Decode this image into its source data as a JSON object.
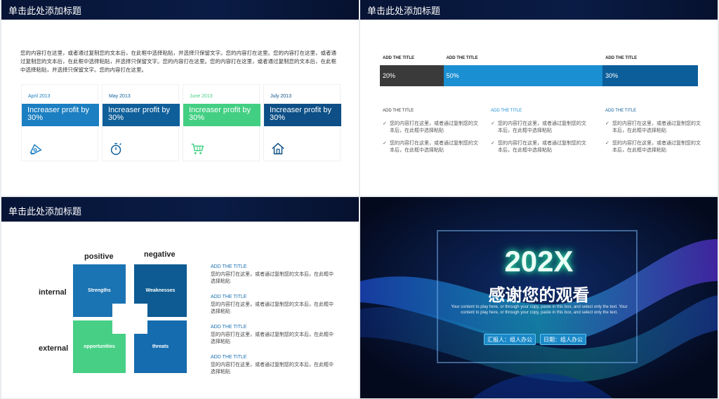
{
  "slide1": {
    "title": "单击此处添加标题",
    "paragraph": "您的内容打在这里，或者通过复制您的文本后，在此框中选择粘贴，并选择只保留文字。您的内容打在这里。您的内容打在这里，或者通过复制您的文本后，在此框中选择粘贴，并选择只保留文字。您的内容打在这里。您的内容打在这里，或者通过复制您的文本后，在此框中选择粘贴，并选择只保留文字。您的内容打在这里。",
    "cards": [
      {
        "month": "April 2013",
        "text": "Increaser profit by 30%",
        "color": "#1b7fc1",
        "icon": "pen-nib-icon"
      },
      {
        "month": "May 2013",
        "text": "Increaser profit by 30%",
        "color": "#0f5f9a",
        "icon": "stopwatch-icon"
      },
      {
        "month": "June 2013",
        "text": "Increaser profit by 30%",
        "color": "#43cf83",
        "icon": "shopping-cart-icon"
      },
      {
        "month": "July 2013",
        "text": "Increaser profit by 30%",
        "color": "#0d4f86",
        "icon": "house-icon"
      }
    ]
  },
  "slide2": {
    "title": "单击此处添加标题",
    "bar_heads": [
      "ADD THE TITLE",
      "ADD THE TITLE",
      "ADD THE TITLE"
    ],
    "bars": [
      {
        "label": "20%",
        "value": 20,
        "color": "#3a3a3a"
      },
      {
        "label": "50%",
        "value": 50,
        "color": "#1a8fd2"
      },
      {
        "label": "30%",
        "value": 30,
        "color": "#0c5e9a"
      }
    ],
    "columns": [
      {
        "title": "ADD THE TITLE",
        "items": [
          "您的内容打在这里，或者通过复制您的文本后，在此框中选择粘贴",
          "您的内容打在这里，或者通过复制您的文本后，在此框中选择粘贴"
        ]
      },
      {
        "title": "ADD THE TITLE",
        "items": [
          "您的内容打在这里，或者通过复制您的文本后，在此框中选择粘贴",
          "您的内容打在这里，或者通过复制您的文本后，在此框中选择粘贴"
        ]
      },
      {
        "title": "ADD THE TITLE",
        "items": [
          "您的内容打在这里，或者通过复制您的文本后，在此框中选择粘贴",
          "您的内容打在这里，或者通过复制您的文本后，在此框中选择粘贴"
        ]
      }
    ]
  },
  "slide3": {
    "title": "单击此处添加标题",
    "labels": {
      "positive": "positive",
      "negative": "negative",
      "internal": "internal",
      "external": "external"
    },
    "swot": {
      "strengths": "Strengths",
      "weaknesses": "Weaknesses",
      "opportunities": "opportunities",
      "threats": "threats"
    },
    "colors": {
      "strengths": "#1a73b3",
      "weaknesses": "#0d5b92",
      "opportunities": "#46cf85",
      "threats": "#156cae"
    },
    "items": [
      {
        "title": "ADD THE TITLE",
        "body": "您的内容打在这里，或者通过复制您的文本后，在此框中选择粘贴"
      },
      {
        "title": "ADD THE TITLE",
        "body": "您的内容打在这里，或者通过复制您的文本后，在此框中选择粘贴"
      },
      {
        "title": "ADD THE TITLE",
        "body": "您的内容打在这里，或者通过复制您的文本后，在此框中选择粘贴"
      },
      {
        "title": "ADD THE TITLE",
        "body": "您的内容打在这里，或者通过复制您的文本后，在此框中选择粘贴"
      }
    ]
  },
  "slide4": {
    "year": "202X",
    "thanks": "感谢您的观看",
    "description": "Your content to play here, or through your copy, paste in this box, and select only the text. Your content to play here, or through your copy, paste in this box, and select only the text.",
    "reporter": "汇报人：组人办公",
    "date": "日期：组人办公"
  }
}
